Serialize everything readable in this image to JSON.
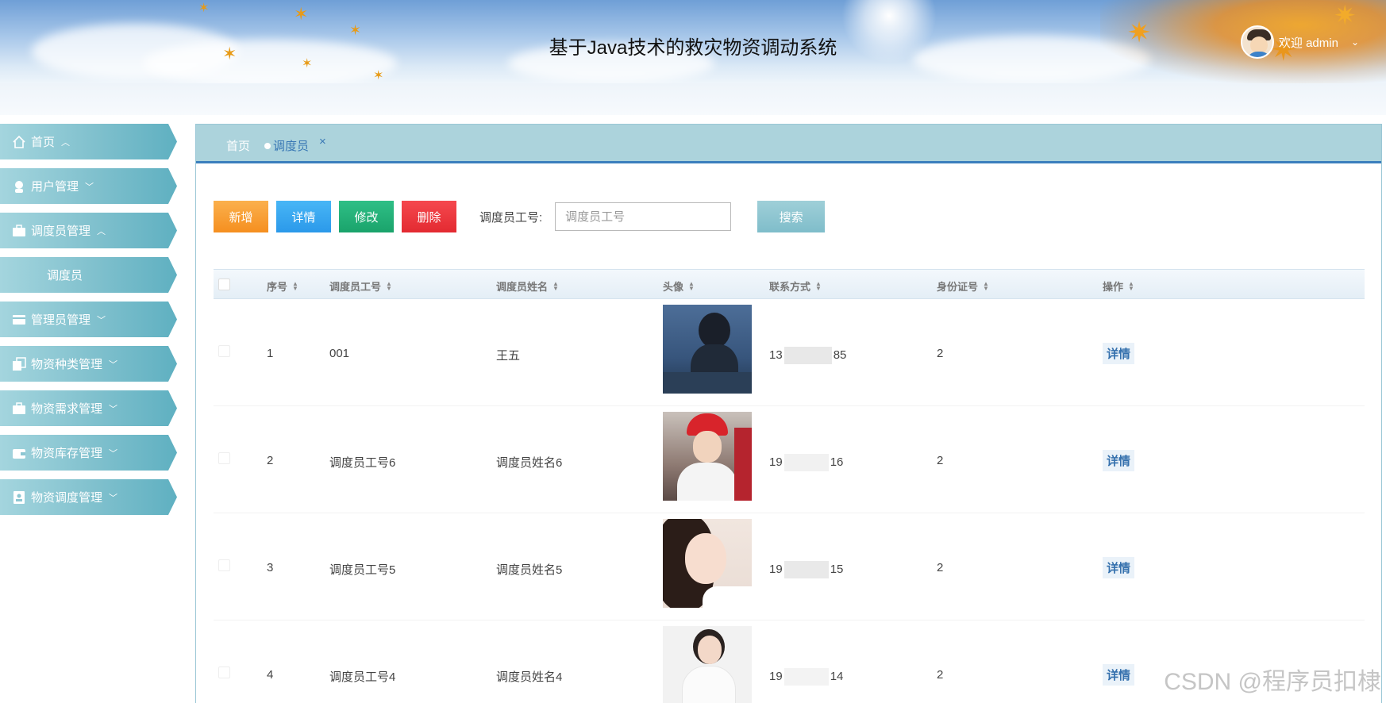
{
  "header": {
    "title": "基于Java技术的救灾物资调动系统",
    "welcome": "欢迎 admin"
  },
  "sidebar": {
    "items": [
      {
        "label": "首页",
        "icon": "home-icon",
        "expanded": true
      },
      {
        "label": "用户管理",
        "icon": "user-icon",
        "expanded": false
      },
      {
        "label": "调度员管理",
        "icon": "briefcase-icon",
        "expanded": true
      },
      {
        "label": "调度员",
        "sub": true
      },
      {
        "label": "管理员管理",
        "icon": "card-icon",
        "expanded": false
      },
      {
        "label": "物资种类管理",
        "icon": "copy-icon",
        "expanded": false
      },
      {
        "label": "物资需求管理",
        "icon": "briefcase-icon",
        "expanded": false
      },
      {
        "label": "物资库存管理",
        "icon": "wallet-icon",
        "expanded": false
      },
      {
        "label": "物资调度管理",
        "icon": "id-badge-icon",
        "expanded": false
      }
    ]
  },
  "tabs": {
    "home": "首页",
    "active": "调度员",
    "close": "×"
  },
  "toolbar": {
    "add": "新增",
    "detail": "详情",
    "edit": "修改",
    "delete": "删除",
    "search_label": "调度员工号:",
    "search_placeholder": "调度员工号",
    "search_button": "搜索"
  },
  "table": {
    "columns": [
      "序号",
      "调度员工号",
      "调度员姓名",
      "头像",
      "联系方式",
      "身份证号",
      "操作"
    ],
    "rows": [
      {
        "no": "1",
        "code": "001",
        "name": "王五",
        "phone_start": "13",
        "phone_end": "85",
        "id_card": "2",
        "action": "详情"
      },
      {
        "no": "2",
        "code": "调度员工号6",
        "name": "调度员姓名6",
        "phone_start": "19",
        "phone_end": "16",
        "id_card": "2",
        "action": "详情"
      },
      {
        "no": "3",
        "code": "调度员工号5",
        "name": "调度员姓名5",
        "phone_start": "19",
        "phone_end": "15",
        "id_card": "2",
        "action": "详情"
      },
      {
        "no": "4",
        "code": "调度员工号4",
        "name": "调度员姓名4",
        "phone_start": "19",
        "phone_end": "14",
        "id_card": "2",
        "action": "详情"
      }
    ]
  },
  "watermark": "CSDN @程序员扣棣"
}
